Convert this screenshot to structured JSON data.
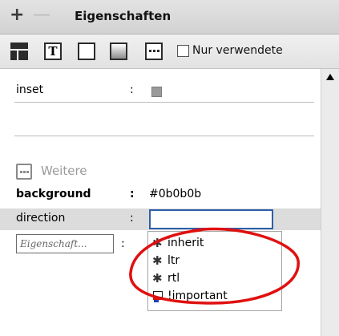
{
  "panel": {
    "title": "Eigenschaften",
    "add_symbol": "+",
    "remove_symbol": "—"
  },
  "toolbar": {
    "icons": [
      "category-view-icon",
      "text-icon",
      "box-icon",
      "background-icon",
      "more-icon"
    ],
    "only_used_label": "Nur verwendete",
    "only_used_checked": false
  },
  "properties": [
    {
      "name": "inset",
      "separator": ":",
      "value_type": "color-swatch",
      "swatch_color": "#9a9a9a"
    }
  ],
  "section": {
    "label": "Weitere"
  },
  "more_properties": [
    {
      "name": "background",
      "separator": ":",
      "value": "#0b0b0b",
      "bold": true
    },
    {
      "name": "direction",
      "separator": ":",
      "value": "",
      "bold": false,
      "editing": true
    }
  ],
  "new_property": {
    "placeholder": "Eigenschaft...",
    "separator": ":"
  },
  "autocomplete": {
    "items": [
      {
        "label": "inherit",
        "icon": "asterisk-icon"
      },
      {
        "label": "ltr",
        "icon": "asterisk-icon"
      },
      {
        "label": "rtl",
        "icon": "asterisk-icon"
      },
      {
        "label": "!important",
        "icon": "important-icon"
      }
    ]
  },
  "annotation": {
    "highlight_color": "#e01010"
  }
}
